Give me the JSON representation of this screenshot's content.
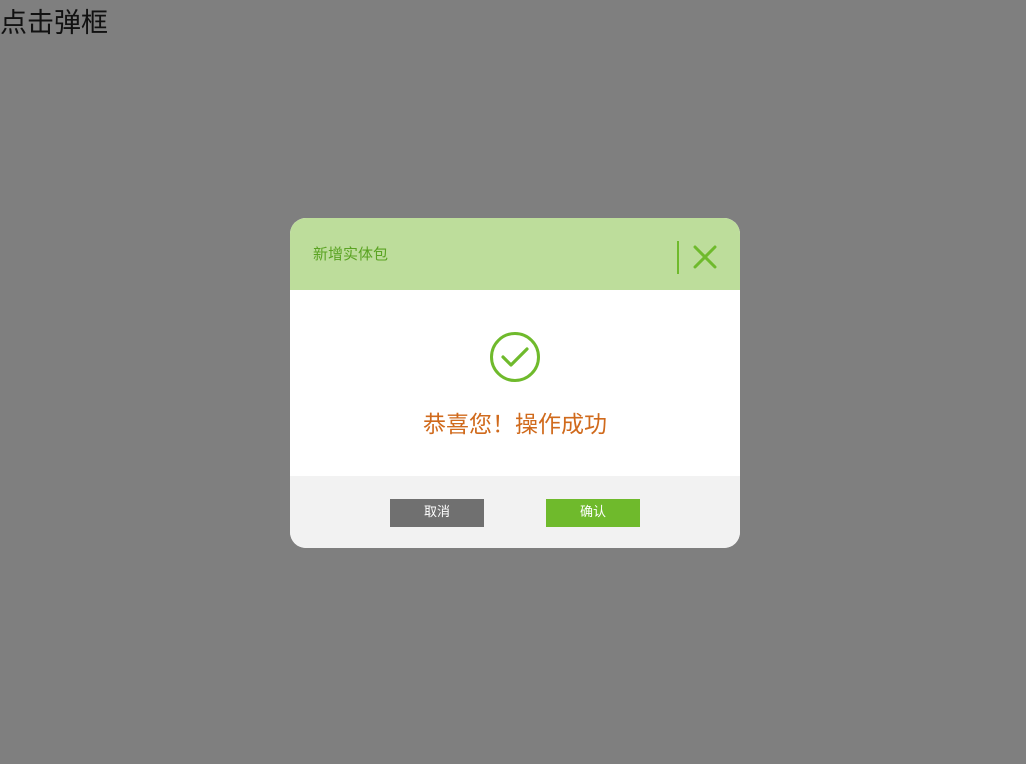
{
  "page": {
    "trigger_link": "点击弹框"
  },
  "dialog": {
    "title": "新增实体包",
    "close_icon": "close-icon",
    "status_icon": "check-circle-icon",
    "message": "恭喜您！操作成功",
    "buttons": {
      "cancel": "取消",
      "confirm": "确认"
    },
    "colors": {
      "overlay": "#808080",
      "header_background": "#bddd9b",
      "title_text": "#5aa322",
      "accent_green": "#6fba2c",
      "message_text": "#d06a1c",
      "footer_background": "#f2f2f2",
      "cancel_button": "#707070"
    }
  }
}
